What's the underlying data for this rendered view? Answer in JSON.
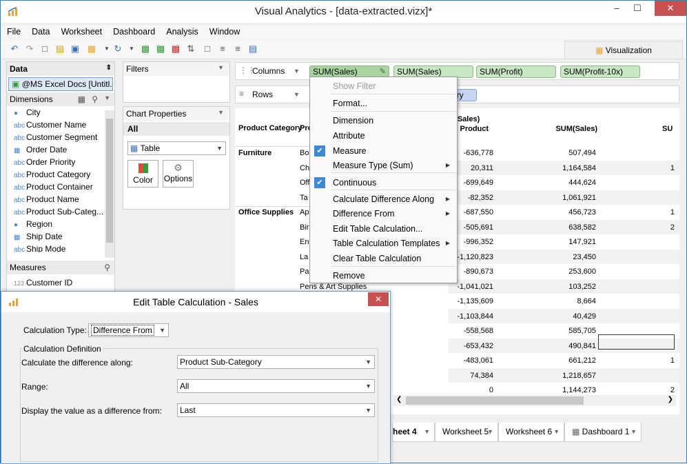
{
  "window": {
    "title": "Visual Analytics - [data-extracted.vizx]*",
    "minimize": "–",
    "maximize": "☐",
    "close": "✕"
  },
  "menu": [
    "File",
    "Data",
    "Worksheet",
    "Dashboard",
    "Analysis",
    "Window"
  ],
  "visualization_tab": "Visualization",
  "data_pane": {
    "title": "Data",
    "source": "@MS Excel Docs [Untitl...",
    "dimensions_title": "Dimensions",
    "dimensions": [
      {
        "icon": "globe-icon",
        "glyph": "●",
        "label": "City"
      },
      {
        "icon": "abc-icon",
        "glyph": "abc",
        "label": "Customer Name"
      },
      {
        "icon": "abc-icon",
        "glyph": "abc",
        "label": "Customer Segment"
      },
      {
        "icon": "calendar-icon",
        "glyph": "▦",
        "label": "Order Date"
      },
      {
        "icon": "abc-icon",
        "glyph": "abc",
        "label": "Order Priority"
      },
      {
        "icon": "abc-icon",
        "glyph": "abc",
        "label": "Product Category"
      },
      {
        "icon": "abc-icon",
        "glyph": "abc",
        "label": "Product Container"
      },
      {
        "icon": "abc-icon",
        "glyph": "abc",
        "label": "Product Name"
      },
      {
        "icon": "abc-icon",
        "glyph": "abc",
        "label": "Product Sub-Categ..."
      },
      {
        "icon": "globe-icon",
        "glyph": "●",
        "label": "Region"
      },
      {
        "icon": "calendar-icon",
        "glyph": "▦",
        "label": "Ship Date"
      },
      {
        "icon": "abc-icon",
        "glyph": "abc",
        "label": "Ship Mode"
      }
    ],
    "measures_title": "Measures",
    "measures": [
      {
        "glyph": "123",
        "label": "Customer ID"
      }
    ]
  },
  "filters": {
    "title": "Filters"
  },
  "chart_properties": {
    "title": "Chart Properties",
    "all": "All",
    "chart_type": "Table",
    "color_label": "Color",
    "options_label": "Options"
  },
  "shelves": {
    "columns_label": "Columns",
    "rows_label": "Rows",
    "columns_pills": [
      "SUM(Sales)",
      "SUM(Sales)",
      "SUM(Profit)",
      "SUM(Profit-10x)"
    ],
    "rows_pill_tail": "ory"
  },
  "table": {
    "header_category": "Product Category",
    "header_subcat": "Pro",
    "header_diff_line1": "M(Sales)",
    "header_diff_line2": "ng Product",
    "header_sales": "SUM(Sales)",
    "header_more": "SU",
    "rows": [
      {
        "cat": "Furniture",
        "sub": "Bo",
        "diff": "-636,778",
        "sales": "507,494",
        "more": ""
      },
      {
        "cat": "",
        "sub": "Ch",
        "diff": "20,311",
        "sales": "1,164,584",
        "more": "1"
      },
      {
        "cat": "",
        "sub": "Off",
        "diff": "-699,649",
        "sales": "444,624",
        "more": ""
      },
      {
        "cat": "",
        "sub": "Ta",
        "diff": "-82,352",
        "sales": "1,061,921",
        "more": ""
      },
      {
        "cat": "Office Supplies",
        "sub": "Ap",
        "diff": "-687,550",
        "sales": "456,723",
        "more": "1"
      },
      {
        "cat": "",
        "sub": "Bir",
        "diff": "-505,691",
        "sales": "638,582",
        "more": "2"
      },
      {
        "cat": "",
        "sub": "En",
        "diff": "-996,352",
        "sales": "147,921",
        "more": ""
      },
      {
        "cat": "",
        "sub": "La",
        "diff": "-1,120,823",
        "sales": "23,450",
        "more": ""
      },
      {
        "cat": "",
        "sub": "Pa",
        "diff": "-890,673",
        "sales": "253,600",
        "more": ""
      },
      {
        "cat": "",
        "sub": "Pens & Art Supplies",
        "diff": "-1,041,021",
        "sales": "103,252",
        "more": ""
      },
      {
        "cat": "",
        "sub": "",
        "diff": "-1,135,609",
        "sales": "8,664",
        "more": ""
      },
      {
        "cat": "",
        "sub": "",
        "diff": "-1,103,844",
        "sales": "40,429",
        "more": ""
      },
      {
        "cat": "",
        "sub": "",
        "diff": "-558,568",
        "sales": "585,705",
        "more": ""
      },
      {
        "cat": "",
        "sub": "",
        "diff": "-653,432",
        "sales": "490,841",
        "more": ""
      },
      {
        "cat": "",
        "sub": "",
        "diff": "-483,061",
        "sales": "661,212",
        "more": "1"
      },
      {
        "cat": "",
        "sub": "",
        "diff": "74,384",
        "sales": "1,218,657",
        "more": ""
      },
      {
        "cat": "",
        "sub": "",
        "diff": "0",
        "sales": "1,144,273",
        "more": "2"
      }
    ]
  },
  "context_menu": {
    "items": [
      {
        "label": "Show Filter",
        "disabled": true
      },
      {
        "label": "Format..."
      },
      {
        "label": "Dimension"
      },
      {
        "label": "Attribute"
      },
      {
        "label": "Measure",
        "checked": true
      },
      {
        "label": "Measure Type (Sum)",
        "submenu": true
      },
      {
        "label": "Continuous",
        "checked": true
      },
      {
        "label": "Calculate Difference Along",
        "submenu": true
      },
      {
        "label": "Difference From",
        "submenu": true
      },
      {
        "label": "Edit Table Calculation..."
      },
      {
        "label": "Table Calculation Templates",
        "submenu": true
      },
      {
        "label": "Clear Table Calculation"
      },
      {
        "label": "Remove"
      }
    ]
  },
  "sheet_tabs": [
    "heet 4",
    "Worksheet 5",
    "Worksheet 6",
    "Dashboard 1"
  ],
  "dialog": {
    "title": "Edit Table Calculation - Sales",
    "calc_type_label": "Calculation Type:",
    "calc_type_value": "Difference From",
    "group_label": "Calculation Definition",
    "along_label": "Calculate the difference along:",
    "along_value": "Product Sub-Category",
    "range_label": "Range:",
    "range_value": "All",
    "display_label": "Display the value as a difference from:",
    "display_value": "Last"
  }
}
